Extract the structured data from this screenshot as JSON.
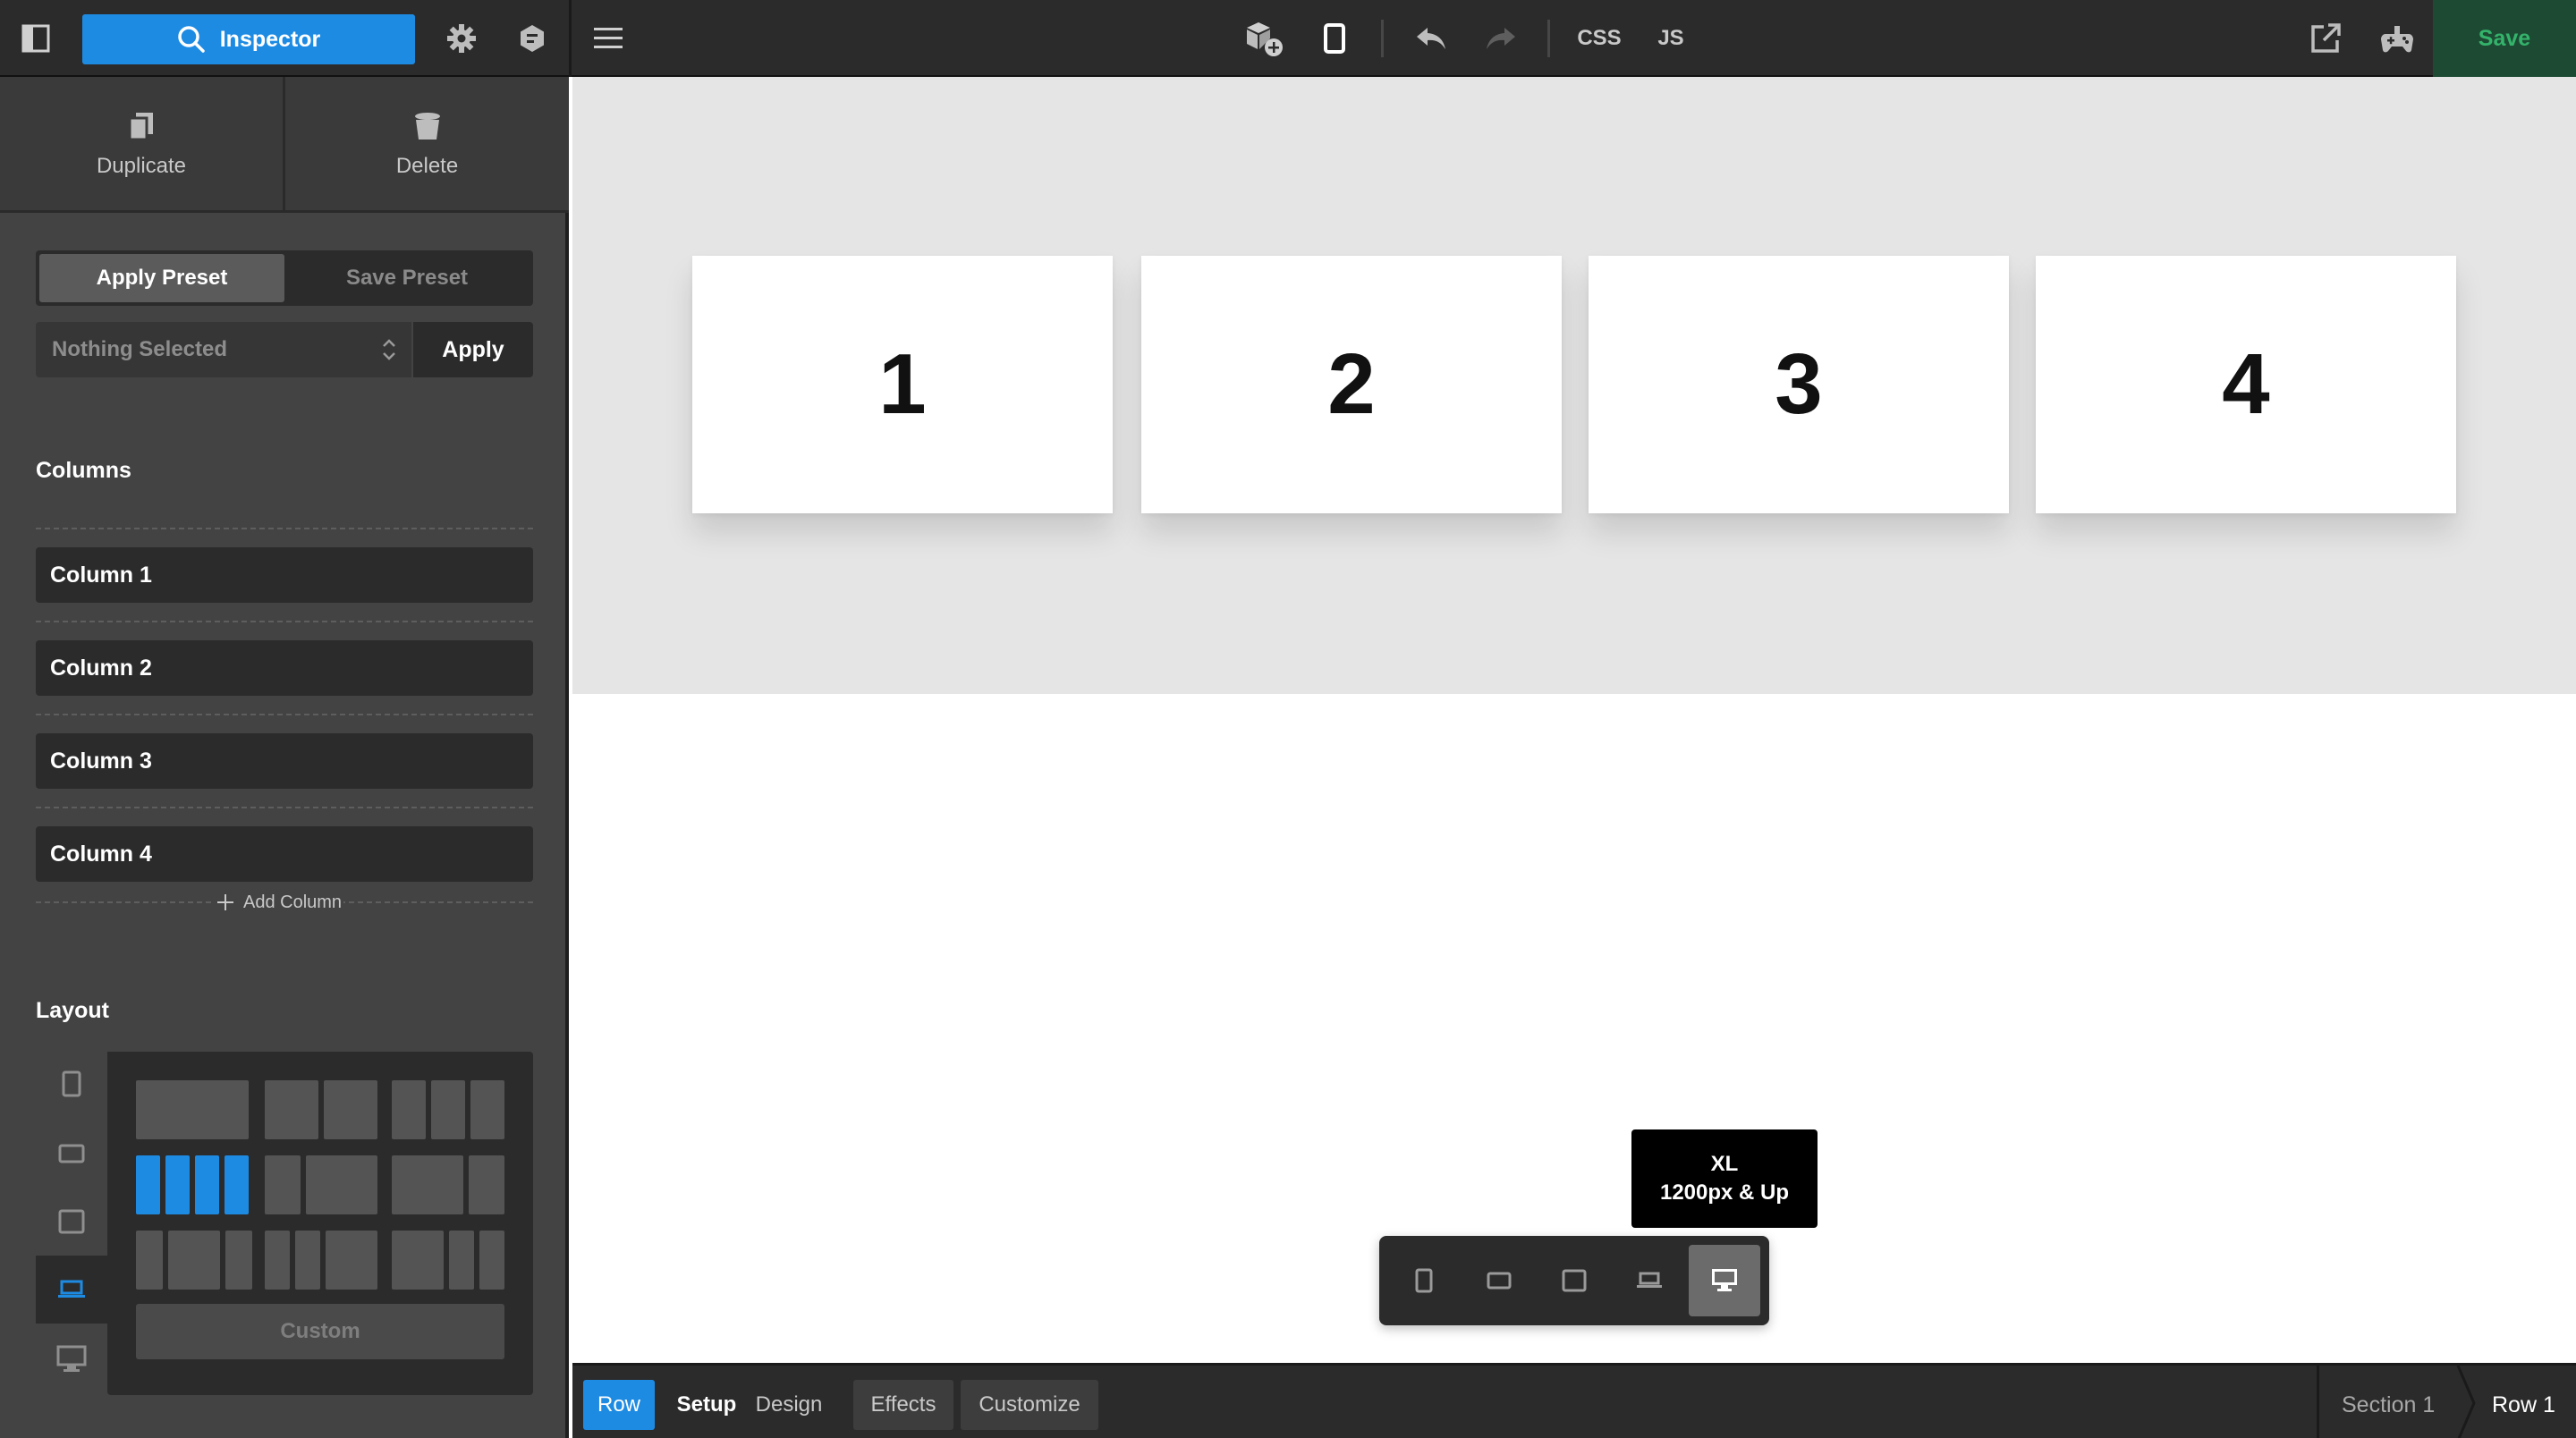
{
  "topbar": {
    "inspector_label": "Inspector",
    "css_label": "CSS",
    "js_label": "JS",
    "save_label": "Save",
    "icons": [
      "sidebar-toggle-icon",
      "search-icon",
      "gear-icon",
      "hexagon-icon",
      "hamburger-icon",
      "add-element-icon",
      "device-icon",
      "undo-icon",
      "redo-icon",
      "external-link-icon",
      "gamepad-icon"
    ]
  },
  "actions": {
    "duplicate": "Duplicate",
    "delete": "Delete"
  },
  "preset": {
    "apply_preset": "Apply Preset",
    "save_preset": "Save Preset",
    "select_value": "Nothing Selected",
    "apply": "Apply"
  },
  "columns": {
    "title": "Columns",
    "items": [
      "Column 1",
      "Column 2",
      "Column 3",
      "Column 4"
    ],
    "add_label": "Add Column"
  },
  "layout": {
    "title": "Layout",
    "custom_label": "Custom",
    "selected": "4 equal columns"
  },
  "canvas": {
    "cards": [
      "1",
      "2",
      "3",
      "4"
    ]
  },
  "breakpoint": {
    "tooltip_title": "XL",
    "tooltip_desc": "1200px & Up",
    "active": "xl"
  },
  "bottombar": {
    "row": "Row",
    "setup": "Setup",
    "design": "Design",
    "effects": "Effects",
    "customize": "Customize",
    "crumb_1": "Section 1",
    "crumb_2": "Row 1"
  },
  "colors": {
    "accent": "#1e8be3",
    "save_bg": "#1d4a33",
    "save_text": "#34b36b",
    "panel": "#434343",
    "dark": "#2b2b2b"
  }
}
